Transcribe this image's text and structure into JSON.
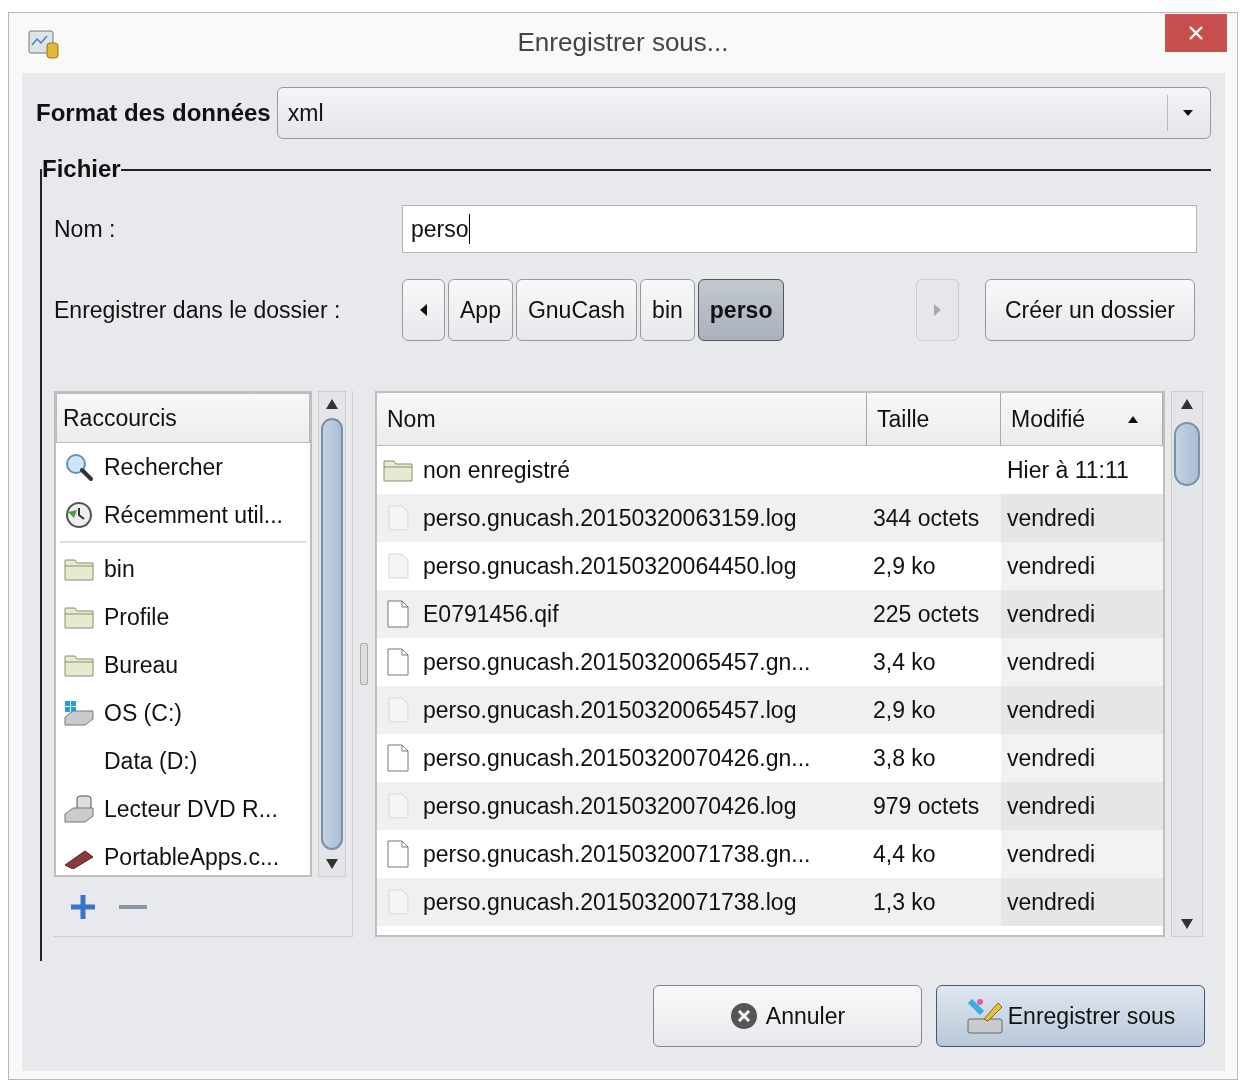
{
  "window": {
    "title": "Enregistrer sous..."
  },
  "format": {
    "label": "Format des données",
    "value": "xml"
  },
  "file_group": {
    "legend": "Fichier"
  },
  "name": {
    "label": "Nom :",
    "value": "perso"
  },
  "folder": {
    "label": "Enregistrer dans le dossier :",
    "path": [
      {
        "label": "App",
        "selected": false
      },
      {
        "label": "GnuCash",
        "selected": false
      },
      {
        "label": "bin",
        "selected": false
      },
      {
        "label": "perso",
        "selected": true
      }
    ],
    "create_button": "Créer un dossier"
  },
  "shortcuts": {
    "header": "Raccourcis",
    "groups": [
      [
        {
          "label": "Rechercher",
          "kind": "search"
        },
        {
          "label": "Récemment util...",
          "kind": "recent"
        }
      ],
      [
        {
          "label": "bin",
          "kind": "folder"
        },
        {
          "label": "Profile",
          "kind": "folder"
        },
        {
          "label": "Bureau",
          "kind": "folder"
        },
        {
          "label": "OS (C:)",
          "kind": "drive"
        },
        {
          "label": "Data (D:)",
          "kind": "blank"
        },
        {
          "label": "Lecteur DVD R...",
          "kind": "dvd"
        },
        {
          "label": "PortableApps.c...",
          "kind": "usb"
        }
      ]
    ]
  },
  "files": {
    "columns": [
      {
        "label": "Nom",
        "sorted": false
      },
      {
        "label": "Taille",
        "sorted": false
      },
      {
        "label": "Modifié",
        "sorted": true
      }
    ],
    "rows": [
      {
        "name": "non enregistré",
        "size": "",
        "modified": "Hier à 11:11",
        "kind": "folder"
      },
      {
        "name": "perso.gnucash.20150320063159.log",
        "size": "344 octets",
        "modified": "vendredi",
        "kind": "log"
      },
      {
        "name": "perso.gnucash.20150320064450.log",
        "size": "2,9 ko",
        "modified": "vendredi",
        "kind": "log"
      },
      {
        "name": "E0791456.qif",
        "size": "225 octets",
        "modified": "vendredi",
        "kind": "file"
      },
      {
        "name": "perso.gnucash.20150320065457.gn...",
        "size": "3,4 ko",
        "modified": "vendredi",
        "kind": "file"
      },
      {
        "name": "perso.gnucash.20150320065457.log",
        "size": "2,9 ko",
        "modified": "vendredi",
        "kind": "log"
      },
      {
        "name": "perso.gnucash.20150320070426.gn...",
        "size": "3,8 ko",
        "modified": "vendredi",
        "kind": "file"
      },
      {
        "name": "perso.gnucash.20150320070426.log",
        "size": "979 octets",
        "modified": "vendredi",
        "kind": "log"
      },
      {
        "name": "perso.gnucash.20150320071738.gn...",
        "size": "4,4 ko",
        "modified": "vendredi",
        "kind": "file"
      },
      {
        "name": "perso.gnucash.20150320071738.log",
        "size": "1,3 ko",
        "modified": "vendredi",
        "kind": "log"
      }
    ]
  },
  "buttons": [
    {
      "label": "Annuler",
      "kind": "cancel"
    },
    {
      "label": "Enregistrer sous",
      "kind": "save"
    }
  ]
}
